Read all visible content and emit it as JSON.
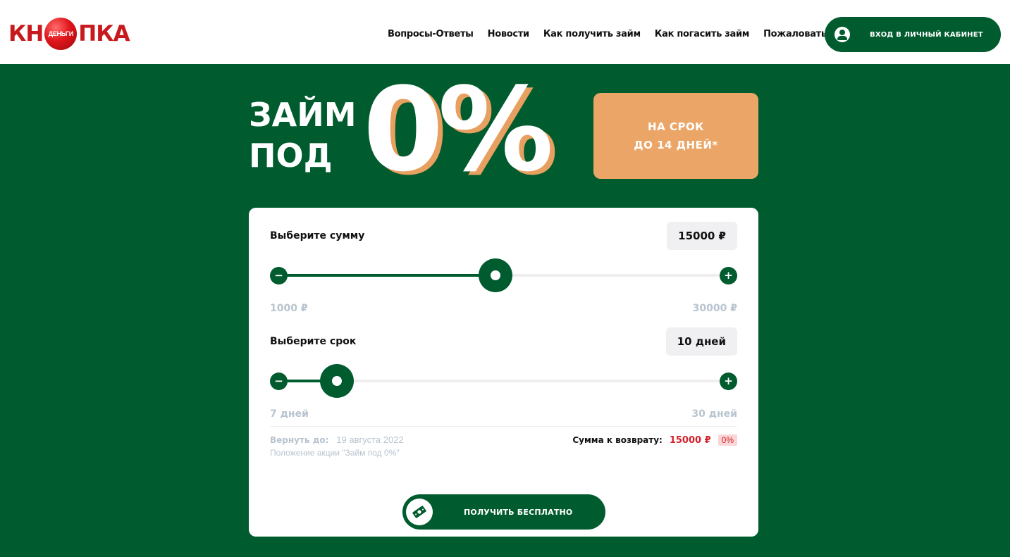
{
  "header": {
    "logo": {
      "left": "КН",
      "ball": "ДЕНЬГИ",
      "right": "ПКА"
    },
    "nav": [
      "Вопросы-Ответы",
      "Новости",
      "Как получить займ",
      "Как погасить займ",
      "Пожаловаться"
    ],
    "login_label": "ВХОД В ЛИЧНЫЙ КАБИНЕТ"
  },
  "hero": {
    "title_line1": "ЗАЙМ",
    "title_line2": "ПОД",
    "rate": "0%",
    "term": "НА СРОК\nДО 14 ДНЕЙ*"
  },
  "calculator": {
    "amount": {
      "label": "Выберите сумму",
      "value": "15000 ₽",
      "min_label": "1000 ₽",
      "max_label": "30000 ₽",
      "min": 1000,
      "max": 30000,
      "current": 15000
    },
    "term": {
      "label": "Выберите срок",
      "value": "10 дней",
      "min_label": "7 дней",
      "max_label": "30 дней",
      "min": 7,
      "max": 30,
      "current": 10
    },
    "due_label": "Вернуть до:",
    "due_date": "19 августа 2022",
    "promo_link": "Положение акции \"Займ под 0%\"",
    "repay_label": "Сумма к возврату:",
    "repay_value": "15000 ₽",
    "repay_rate": "0%",
    "minus_symbol": "−",
    "plus_symbol": "+",
    "cta_label": "ПОЛУЧИТЬ БЕСПЛАТНО"
  },
  "colors": {
    "brand_green": "#005c2e",
    "accent_orange": "#eba566",
    "logo_red": "#c8191c",
    "repay_red": "#d2202a"
  }
}
